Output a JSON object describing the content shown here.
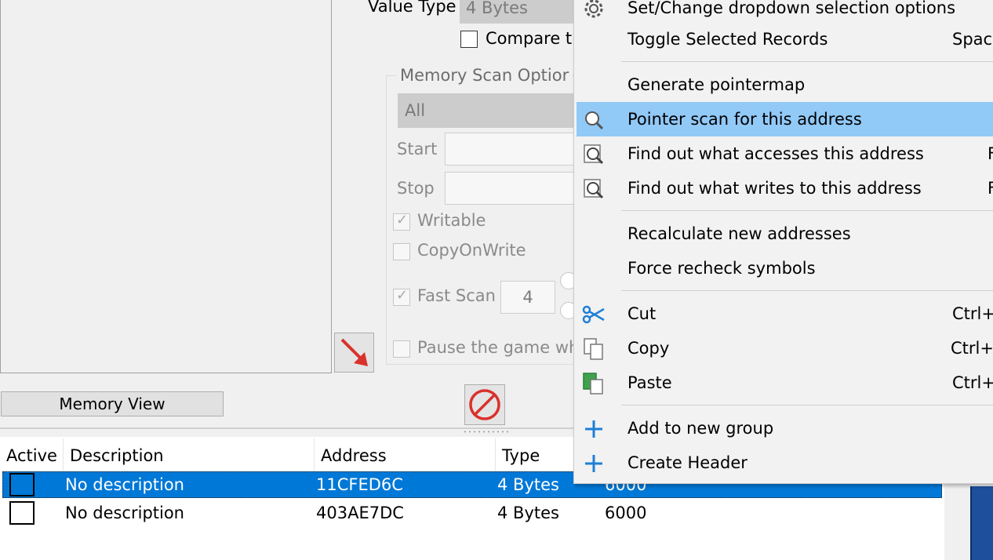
{
  "scan_panel": {
    "value_type_label": "Value Type",
    "value_type_value": "4 Bytes",
    "compare_label": "Compare t",
    "memory_scan_options_title": "Memory Scan Optior",
    "region_value": "All",
    "start_label": "Start",
    "stop_label": "Stop",
    "writable_label": "Writable",
    "copyonwrite_label": "CopyOnWrite",
    "fast_scan_label": "Fast Scan",
    "fast_scan_value": "4",
    "pause_label": "Pause the game wh",
    "memory_view_label": "Memory View"
  },
  "address_list": {
    "columns": [
      "Active",
      "Description",
      "Address",
      "Type"
    ],
    "rows": [
      {
        "description": "No description",
        "address": "11CFED6C",
        "type": "4 Bytes",
        "value": "6000",
        "selected": true
      },
      {
        "description": "No description",
        "address": "403AE7DC",
        "type": "4 Bytes",
        "value": "6000",
        "selected": false
      }
    ]
  },
  "context_menu": {
    "items": [
      {
        "label": "Set/Change dropdown selection options",
        "shortcut": "",
        "icon": "gear-icon"
      },
      {
        "label": "Toggle Selected Records",
        "shortcut": "Spac",
        "icon": ""
      },
      {
        "label": "Generate pointermap",
        "shortcut": "",
        "icon": ""
      },
      {
        "label": "Pointer scan for this address",
        "shortcut": "",
        "icon": "magnifier-icon",
        "highlighted": true
      },
      {
        "label": "Find out what accesses this address",
        "shortcut": "F",
        "icon": "debug-magnifier-icon"
      },
      {
        "label": "Find out what writes to this address",
        "shortcut": "F",
        "icon": "debug-magnifier-icon"
      },
      {
        "label": "Recalculate new addresses",
        "shortcut": "",
        "icon": ""
      },
      {
        "label": "Force recheck symbols",
        "shortcut": "",
        "icon": ""
      },
      {
        "label": "Cut",
        "shortcut": "Ctrl+",
        "icon": "scissors-icon"
      },
      {
        "label": "Copy",
        "shortcut": "Ctrl+",
        "icon": "copy-icon"
      },
      {
        "label": "Paste",
        "shortcut": "Ctrl+",
        "icon": "paste-icon"
      },
      {
        "label": "Add to new group",
        "shortcut": "",
        "icon": "plus-icon"
      },
      {
        "label": "Create Header",
        "shortcut": "",
        "icon": "plus-icon"
      }
    ]
  },
  "colors": {
    "selection": "#0078d7",
    "menu_highlight": "#91c9f7",
    "arrow_red": "#d9312b",
    "plus_blue": "#1e7fd6"
  }
}
